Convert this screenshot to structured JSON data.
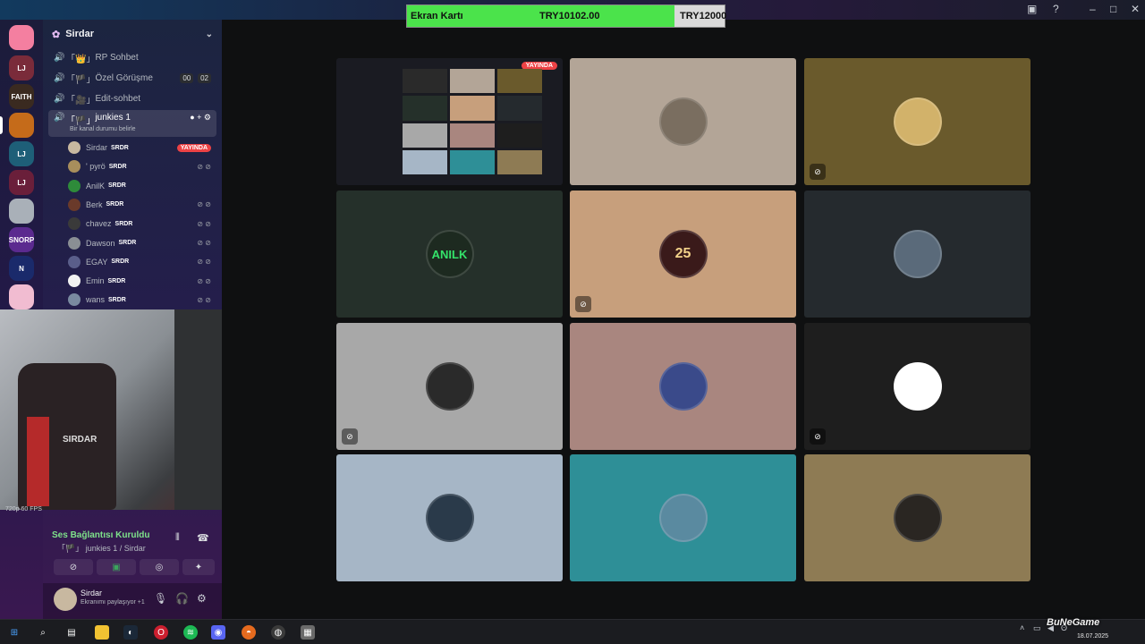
{
  "window": {
    "minimize": "–",
    "maximize": "□",
    "close": "✕"
  },
  "progress": {
    "label": "Ekran Kartı",
    "current": "TRY10102.00",
    "target": "TRY12000",
    "fraction": 0.8418
  },
  "server": {
    "name": "Sirdar",
    "chevron": "⌄"
  },
  "rail": [
    {
      "name": "home",
      "label": "",
      "color": "#f47fa0"
    },
    {
      "name": "server-lj-1",
      "label": "LJ",
      "color": "#7a2b3a"
    },
    {
      "name": "server-faith",
      "label": "FAITH",
      "color": "#3a2a20"
    },
    {
      "name": "server-orange",
      "label": "",
      "color": "#c56b1a"
    },
    {
      "name": "server-lj-2",
      "label": "LJ",
      "color": "#1e5f78"
    },
    {
      "name": "server-lj-3",
      "label": "LJ",
      "color": "#6a1f3a"
    },
    {
      "name": "server-cat",
      "label": "",
      "color": "#a9b0b8"
    },
    {
      "name": "server-snorp",
      "label": "SNORP",
      "color": "#5b2a8f"
    },
    {
      "name": "server-n",
      "label": "N",
      "color": "#1a2a6b"
    },
    {
      "name": "server-pink",
      "label": "",
      "color": "#f1bcd1"
    }
  ],
  "channels": [
    {
      "label": "RP Sohbet",
      "prefix": "「👑」"
    },
    {
      "label": "Özel Görüşme",
      "prefix": "「🏴」",
      "tag1": "00",
      "tag2": "02"
    },
    {
      "label": "Edit-sohbet",
      "prefix": "「🎥」"
    },
    {
      "label": "junkies 1",
      "prefix": "「🏴」",
      "status": "Bir kanal durumu belirle"
    }
  ],
  "members": [
    {
      "name": "Sirdar",
      "rank": "SRDR",
      "live": "YAYINDA",
      "color": "#c8b8a0"
    },
    {
      "name": "' pyrö",
      "rank": "SRDR",
      "color": "#a88e5c"
    },
    {
      "name": "AnilK",
      "rank": "SRDR",
      "color": "#2e8b3a"
    },
    {
      "name": "Berk",
      "rank": "SRDR",
      "color": "#6a3a2a"
    },
    {
      "name": "chavez",
      "rank": "SRDR",
      "color": "#3a3a3a"
    },
    {
      "name": "Dawson",
      "rank": "SRDR",
      "color": "#8a8f94"
    },
    {
      "name": "EGAY",
      "rank": "SRDR",
      "color": "#5a5e8a"
    },
    {
      "name": "Emin",
      "rank": "SRDR",
      "color": "#f2f2f2"
    },
    {
      "name": "wans",
      "rank": "SRDR",
      "color": "#7a8aa0"
    }
  ],
  "cam": {
    "fps": "720p 60 FPS",
    "chair_label": "SIRDAR"
  },
  "voice": {
    "status": "Ses Bağlantısı Kuruldu",
    "channel": "「🏴」 junkies 1 / Sirdar"
  },
  "user": {
    "name": "Sirdar",
    "status": "Ekranımı paylaşıyor +1"
  },
  "tiles": [
    {
      "name": "tile-stream",
      "color": "#1a1b22",
      "live": "YAYINDA"
    },
    {
      "name": "tile-user-2",
      "color": "#b3a597",
      "avatar": "#7a6e60"
    },
    {
      "name": "tile-user-3",
      "color": "#6a5a2c",
      "avatar": "#d2b26a",
      "muted": true
    },
    {
      "name": "tile-anilk",
      "color": "#25302a",
      "avatar": "#1d2a20",
      "avatar_text": "ANILK"
    },
    {
      "name": "tile-25",
      "color": "#c79f7c",
      "avatar": "#3a1a1a",
      "avatar_text": "25",
      "muted": true
    },
    {
      "name": "tile-user-6",
      "color": "#252a2e",
      "avatar": "#5a6a7a"
    },
    {
      "name": "tile-user-7",
      "color": "#a8a8a8",
      "avatar": "#2a2a2a",
      "muted": true
    },
    {
      "name": "tile-user-8",
      "color": "#a9867f",
      "avatar": "#3a4a8a"
    },
    {
      "name": "tile-panda",
      "color": "#1e1e1e",
      "avatar": "#ffffff",
      "muted": true
    },
    {
      "name": "tile-user-10",
      "color": "#a6b6c6",
      "avatar": "#2a3a4a"
    },
    {
      "name": "tile-user-11",
      "color": "#2e8f97",
      "avatar": "#5a8aa0"
    },
    {
      "name": "tile-user-12",
      "color": "#8e7b54",
      "avatar": "#2a2622"
    }
  ],
  "taskbar": {
    "date": "18.07.2025",
    "watermark": "BuNeGame"
  }
}
